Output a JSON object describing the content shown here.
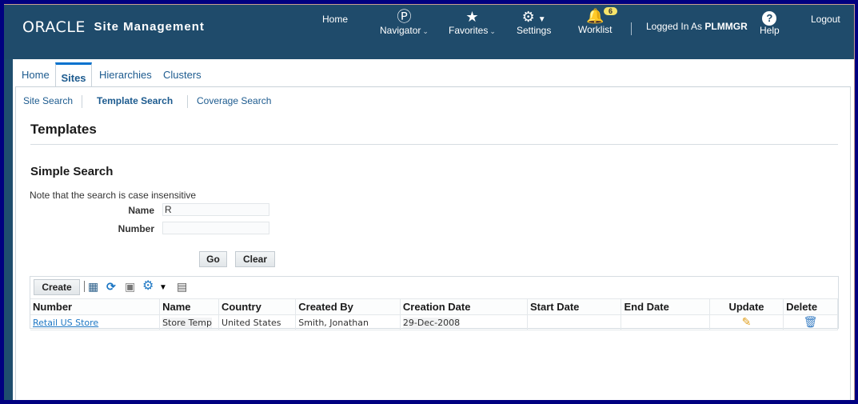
{
  "header": {
    "logo_brand": "ORACLE",
    "app_title": "Site Management",
    "nav": {
      "home": "Home",
      "navigator": "Navigator",
      "favorites": "Favorites",
      "settings": "Settings",
      "worklist": "Worklist",
      "worklist_badge": "6",
      "help": "Help",
      "logout": "Logout"
    },
    "logged_in_prefix": "Logged In As",
    "user": "PLMMGR"
  },
  "tabs": [
    {
      "label": "Home",
      "active": false
    },
    {
      "label": "Sites",
      "active": true
    },
    {
      "label": "Hierarchies",
      "active": false
    },
    {
      "label": "Clusters",
      "active": false
    }
  ],
  "subtabs": [
    {
      "label": "Site Search",
      "active": false
    },
    {
      "label": "Template Search",
      "active": true
    },
    {
      "label": "Coverage Search",
      "active": false
    }
  ],
  "page_title": "Templates",
  "search": {
    "title": "Simple Search",
    "note": "Note that the search is case insensitive",
    "name_label": "Name",
    "name_value": "R",
    "number_label": "Number",
    "number_value": "",
    "go_label": "Go",
    "clear_label": "Clear"
  },
  "table": {
    "create_label": "Create",
    "toolbar_icons": [
      "detach-icon",
      "refresh-icon",
      "reset-icon",
      "settings-gear-icon",
      "columns-icon"
    ],
    "columns": [
      "Number",
      "Name",
      "Country",
      "Created By",
      "Creation Date",
      "Start Date",
      "End Date",
      "Update",
      "Delete"
    ],
    "rows": [
      {
        "number": "Retail US Store",
        "name": "Store Temp",
        "country": "United States",
        "created_by": "Smith, Jonathan",
        "creation_date": "29-Dec-2008",
        "start_date": "",
        "end_date": ""
      }
    ]
  }
}
